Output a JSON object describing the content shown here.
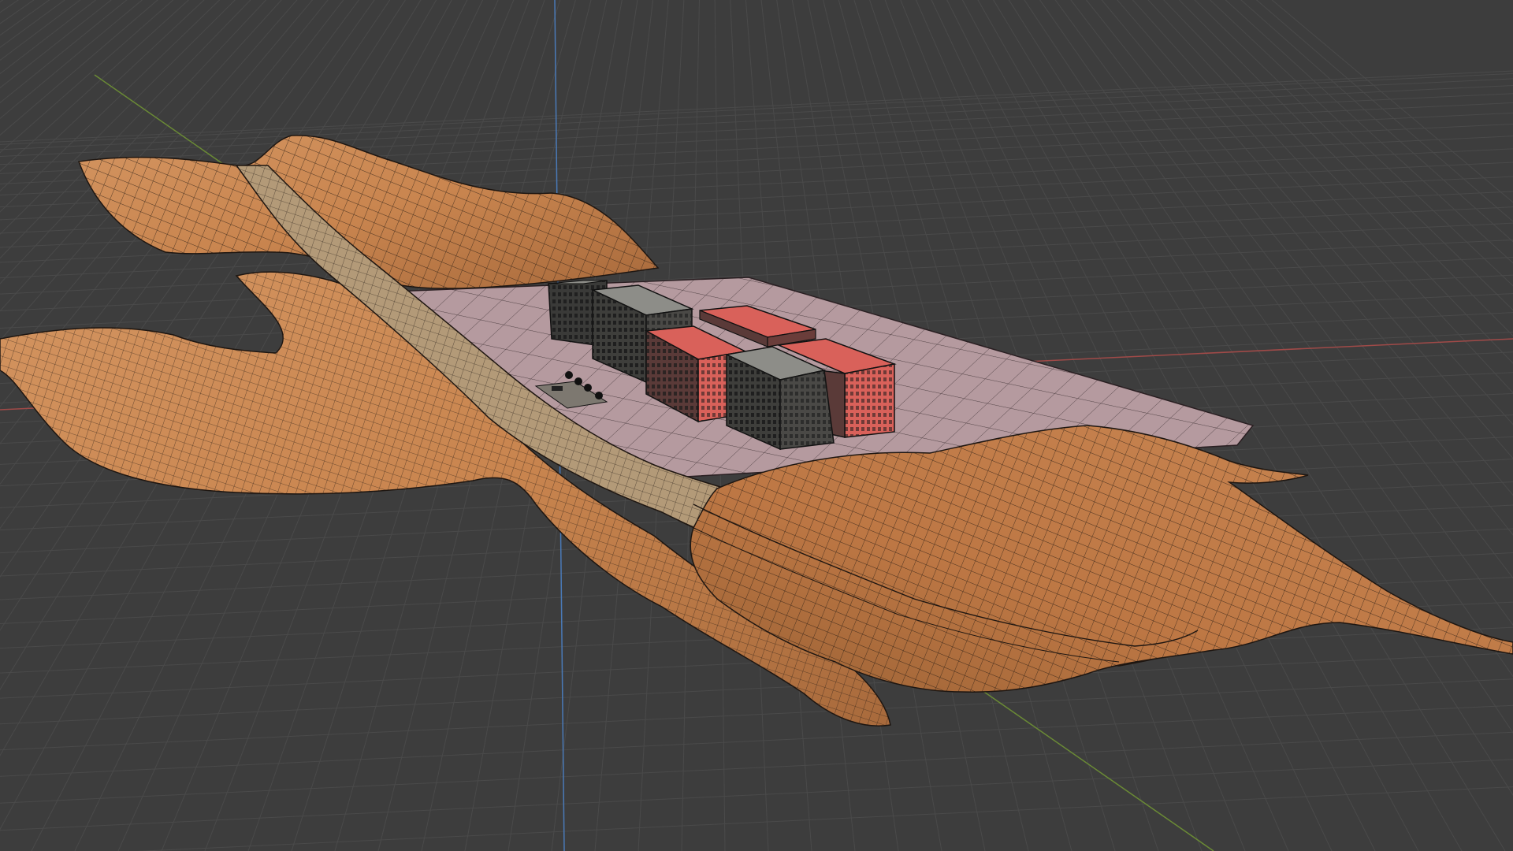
{
  "viewport": {
    "background_color": "#3d3d3d",
    "grid_color": "#4a4a4a",
    "axis_colors": {
      "x": "#a04a48",
      "y": "#6a8a35",
      "z": "#4a7ab8"
    },
    "material_colors": {
      "terrain": "#c9854f",
      "terrain_shadow": "#a86a3c",
      "road": "#b39a78",
      "plaza": "#b59a9f",
      "building_roof_red": "#d9615a",
      "building_roof_gray": "#8d8d88",
      "wire": "#1e1611"
    },
    "objects": [
      "terrain-left",
      "terrain-right",
      "road-strip",
      "plaza-plane",
      "building-block-1",
      "building-block-2",
      "building-block-3",
      "building-block-4",
      "building-block-5",
      "trees-group"
    ]
  }
}
